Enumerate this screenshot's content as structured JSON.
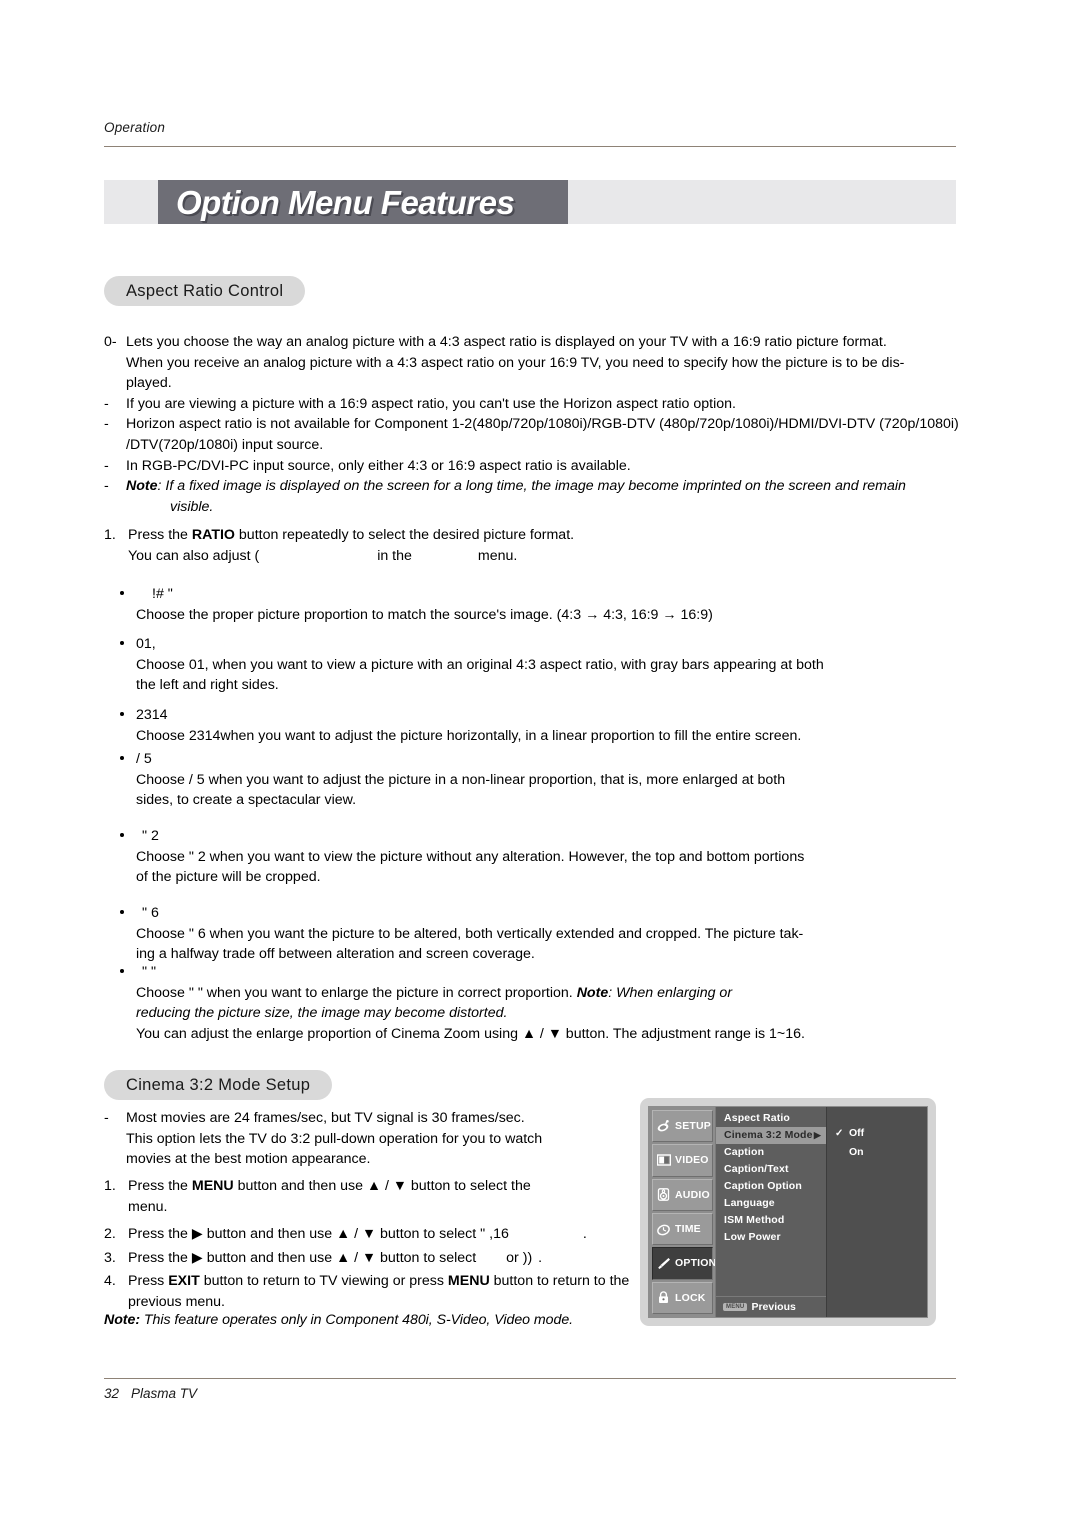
{
  "header": {
    "running_head": "Operation",
    "title": "Option Menu Features"
  },
  "sections": {
    "aspect_ratio_pill": "Aspect Ratio Control",
    "cinema_pill": "Cinema 3:2 Mode Setup"
  },
  "aspect_intro": [
    {
      "marker": "0-",
      "lines": [
        "Lets you choose the way an analog picture with a 4:3 aspect ratio is displayed on your TV with a 16:9 ratio picture format.",
        "When you receive an analog picture with a 4:3 aspect ratio on your 16:9 TV, you need to specify how the picture is to be dis-",
        "played."
      ]
    },
    {
      "marker": "-",
      "lines": [
        "If you are viewing a picture with a 16:9 aspect ratio, you can't use the Horizon aspect ratio option."
      ]
    },
    {
      "marker": "-",
      "lines": [
        "Horizon aspect ratio is not available for Component 1-2(480p/720p/1080i)/RGB-DTV (480p/720p/1080i)/HDMI/DVI-DTV (720p/1080i)",
        "/DTV(720p/1080i) input source."
      ]
    },
    {
      "marker": "-",
      "lines": [
        "In RGB-PC/DVI-PC input source, only either 4:3 or 16:9 aspect ratio is available."
      ]
    }
  ],
  "aspect_note": {
    "marker": "-",
    "label": "Note",
    "sep": ":",
    "text": " If a fixed image is displayed on the screen for a long time, the image may become imprinted on the screen and remain",
    "text_line2": "visible."
  },
  "step1": {
    "number": "1.",
    "before_ratio": "Press the ",
    "ratio": "RATIO",
    "after_ratio": " button repeatedly to select the desired picture format.",
    "line2_a": "You can also adjust ",
    "line2_glyph": "(",
    "line2_b": "in the",
    "line2_c": "menu."
  },
  "bullets": [
    {
      "glyph": "!#      \"",
      "body_pre": "Choose the proper picture proportion to match the source's image.  (4:3 ",
      "arrow1": "→",
      "body_mid": " 4:3, 16:9 ",
      "arrow2": "→",
      "body_post": " 16:9)",
      "body_line2": ""
    },
    {
      "glyph": "01,",
      "body_pre": "Choose ",
      "body_glyph": "01,",
      "body_post": " when you want to view a picture with an original 4:3 aspect ratio, with gray bars appearing at both",
      "body_line2": "the left and right sides."
    },
    {
      "glyph": "2314",
      "body_pre": "Choose ",
      "body_glyph": "2314",
      "body_post": "when you want to adjust the picture horizontally, in a linear proportion to fill the entire screen.",
      "body_line2": ""
    },
    {
      "glyph": "/  5",
      "body_pre": "Choose ",
      "body_glyph": "/  5",
      "body_post": "     when you want to adjust the picture in a non-linear proportion, that is, more enlarged at both",
      "body_line2": "sides, to create a spectacular view."
    },
    {
      "glyph": "\" 2",
      "body_pre": "Choose  ",
      "body_glyph": "\" 2",
      "body_post": "     when you want to view the picture without any alteration. However, the top and bottom portions",
      "body_line2": "of the picture will be cropped."
    },
    {
      "glyph": "\" 6",
      "body_pre": "Choose  ",
      "body_glyph": "\" 6",
      "body_post": "     when you want the picture to be altered, both vertically extended and cropped. The picture tak-",
      "body_line2": "ing a halfway trade off between alteration and screen coverage."
    }
  ],
  "bullet_last": {
    "glyph": "\"   \"",
    "body_pre": "Choose  ",
    "body_glyph": "\"   \"",
    "body_post": "          when you want to enlarge the picture in correct proportion. ",
    "note_label": "Note",
    "note_sep": ":",
    "note_text": " When enlarging or",
    "note_line2": "reducing the picture size, the image may become distorted.",
    "line3_a": "You can adjust the enlarge proportion of Cinema Zoom using ",
    "up": "▲",
    "slash": " / ",
    "down": "▼",
    "line3_b": " button. The adjustment range is 1~16."
  },
  "cinema": {
    "dash": "-",
    "intro": [
      "Most movies are 24 frames/sec, but TV signal is 30 frames/sec.",
      "This option lets the TV do 3:2 pull-down operation for you to watch",
      "movies at the best motion appearance."
    ],
    "steps": [
      {
        "number": "1.",
        "a": "Press the ",
        "bold1": "MENU",
        "b": " button and then use ",
        "up": "▲",
        "slash": " / ",
        "down": "▼",
        "c": " button to select the",
        "d": "menu.",
        "bold2": ""
      },
      {
        "number": "2.",
        "a": "Press the ",
        "bold1": "▶",
        "b": " button and then use ",
        "up": "▲",
        "slash": " / ",
        "down": "▼",
        "c": " button to select  ",
        "d": "\" ,16",
        "bold2": "."
      },
      {
        "number": "3.",
        "a": "Press the ",
        "bold1": "▶",
        "b": " button and then use ",
        "up": "▲",
        "slash": " / ",
        "down": "▼",
        "c": " button to select ",
        "d": "or  ))",
        "bold2": "."
      },
      {
        "number": "4.",
        "a": "Press ",
        "bold1": "EXIT",
        "b": " button to return to TV viewing or press ",
        "up": "",
        "slash": "",
        "down": "",
        "c": "",
        "d": "",
        "bold2": "MENU",
        "tail": " button to return to the",
        "line2": "previous menu."
      }
    ],
    "note_label": "Note:",
    "note_text": " This feature operates only in Component 480i, S-Video, Video mode."
  },
  "osd": {
    "tabs": [
      {
        "label": "SETUP",
        "icon": "satellite-dish-icon",
        "active": false
      },
      {
        "label": "VIDEO",
        "icon": "monitor-icon",
        "active": false
      },
      {
        "label": "AUDIO",
        "icon": "speaker-icon",
        "active": false
      },
      {
        "label": "TIME",
        "icon": "clock-icon",
        "active": false
      },
      {
        "label": "OPTION",
        "icon": "brush-icon",
        "active": true
      },
      {
        "label": "LOCK",
        "icon": "lock-icon",
        "active": false
      }
    ],
    "items": [
      {
        "label": "Aspect Ratio",
        "highlighted": false,
        "arrow": ""
      },
      {
        "label": "Cinema 3:2 Mode",
        "highlighted": true,
        "arrow": "▶"
      },
      {
        "label": "Caption",
        "highlighted": false,
        "arrow": ""
      },
      {
        "label": "Caption/Text",
        "highlighted": false,
        "arrow": ""
      },
      {
        "label": "Caption Option",
        "highlighted": false,
        "arrow": ""
      },
      {
        "label": "Language",
        "highlighted": false,
        "arrow": ""
      },
      {
        "label": "ISM Method",
        "highlighted": false,
        "arrow": ""
      },
      {
        "label": "Low Power",
        "highlighted": false,
        "arrow": ""
      }
    ],
    "previous_badge": "MENU",
    "previous_label": "Previous",
    "options": [
      {
        "label": "Off",
        "checked": true,
        "check": "✓"
      },
      {
        "label": "On",
        "checked": false,
        "check": ""
      }
    ]
  },
  "footer": {
    "page": "32",
    "label": "Plasma TV"
  },
  "colors": {
    "title_block": "#6e6e76",
    "title_strip": "#e8e8ea",
    "pill": "#d9d9d9",
    "rule": "#8e8276",
    "osd_bg": "#5b5b5b",
    "osd_sidebar": "#8d8d8d",
    "osd_active": "#3f3f3f",
    "osd_highlight": "#9c9c9c"
  }
}
